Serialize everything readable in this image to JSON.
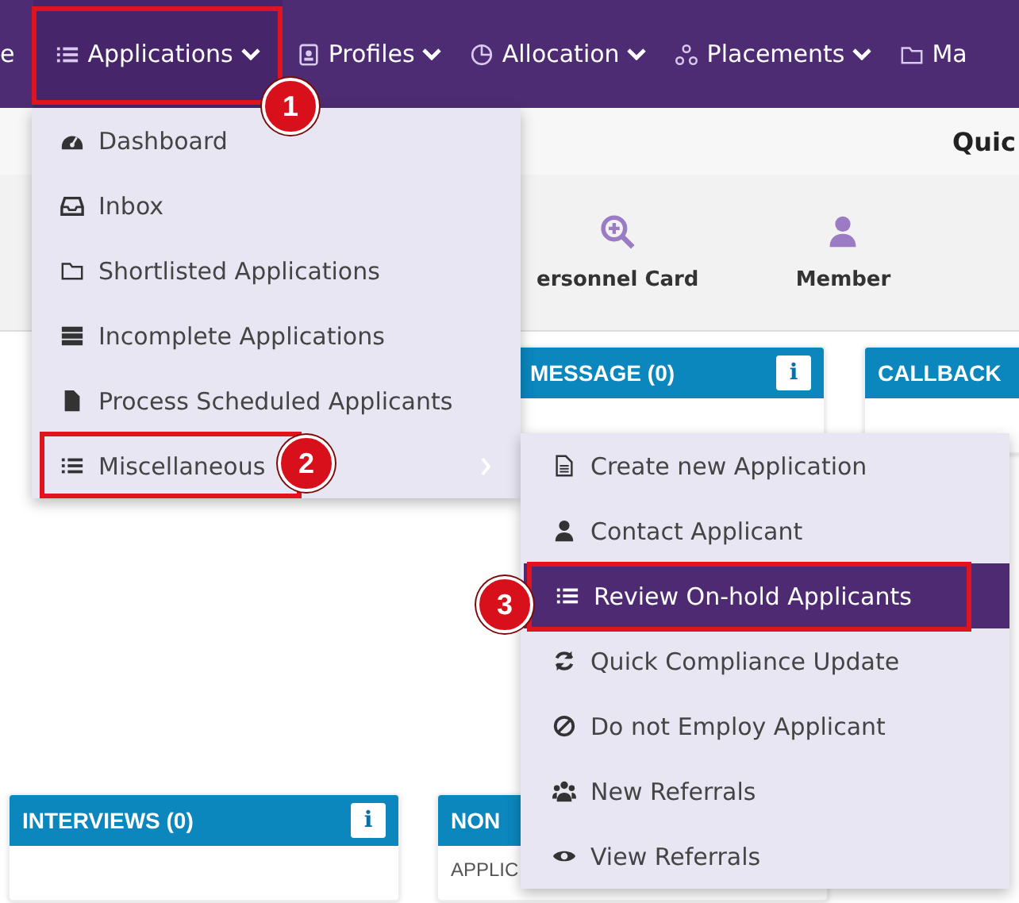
{
  "nav": {
    "items": [
      {
        "label": "e",
        "dropdown": false,
        "selected": false
      },
      {
        "label": "Applications",
        "dropdown": true,
        "selected": true
      },
      {
        "label": "Profiles",
        "dropdown": true,
        "selected": false
      },
      {
        "label": "Allocation",
        "dropdown": true,
        "selected": false
      },
      {
        "label": "Placements",
        "dropdown": true,
        "selected": false
      },
      {
        "label": "Ma",
        "dropdown": false,
        "selected": false
      }
    ]
  },
  "subheader": {
    "title": "Quic"
  },
  "quick_links": [
    {
      "label": "ersonnel Card"
    },
    {
      "label": "Member"
    }
  ],
  "panels_row_1": [
    {
      "title": "MESSAGE (0)",
      "info_label": "i"
    },
    {
      "title": "CALLBACK"
    }
  ],
  "panels_row_2": [
    {
      "title": "INTERVIEWS (0)",
      "info_label": "i"
    },
    {
      "title": "NON",
      "subtitle": "APPLIC"
    }
  ],
  "menu": {
    "items": [
      {
        "label": "Dashboard",
        "submenu": false
      },
      {
        "label": "Inbox",
        "submenu": false
      },
      {
        "label": "Shortlisted Applications",
        "submenu": false
      },
      {
        "label": "Incomplete Applications",
        "submenu": false
      },
      {
        "label": "Process Scheduled Applicants",
        "submenu": false
      },
      {
        "label": "Miscellaneous",
        "submenu": true
      }
    ]
  },
  "submenu": {
    "items": [
      {
        "label": "Create new Application",
        "selected": false
      },
      {
        "label": "Contact Applicant",
        "selected": false
      },
      {
        "label": "Review On-hold Applicants",
        "selected": true
      },
      {
        "label": "Quick Compliance Update",
        "selected": false
      },
      {
        "label": "Do not Employ Applicant",
        "selected": false
      },
      {
        "label": "New Referrals",
        "selected": false
      },
      {
        "label": "View Referrals",
        "selected": false
      }
    ]
  },
  "annotations": [
    {
      "number": "1"
    },
    {
      "number": "2"
    },
    {
      "number": "3"
    }
  ]
}
